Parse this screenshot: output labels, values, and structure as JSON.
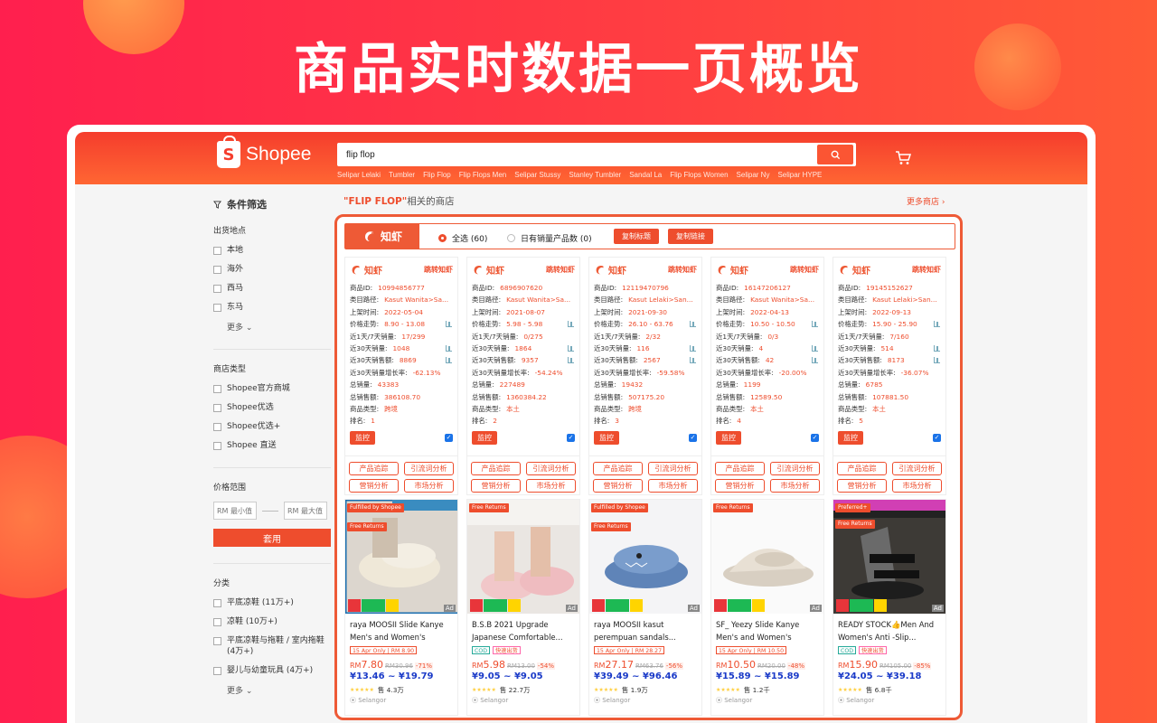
{
  "banner": {
    "title": "商品实时数据一页概览"
  },
  "header": {
    "logo_text": "Shopee",
    "search_value": "flip flop",
    "suggestions": [
      "Selipar Lelaki",
      "Tumbler",
      "Flip Flop",
      "Flip Flops Men",
      "Selipar Stussy",
      "Stanley Tumbler",
      "Sandal La",
      "Flip Flops Women",
      "Selipar Ny",
      "Selipar HYPE"
    ]
  },
  "sidebar": {
    "filter_title": "条件筛选",
    "shipping": {
      "title": "出货地点",
      "options": [
        "本地",
        "海外",
        "西马",
        "东马"
      ],
      "more": "更多"
    },
    "shop_type": {
      "title": "商店类型",
      "options": [
        "Shopee官方商城",
        "Shopee优选",
        "Shopee优选+",
        "Shopee 直送"
      ]
    },
    "price": {
      "title": "价格范围",
      "min_placeholder": "RM 最小值",
      "max_placeholder": "RM 最大值",
      "apply": "套用"
    },
    "category": {
      "title": "分类",
      "options": [
        "平底凉鞋 (11万+)",
        "凉鞋 (10万+)",
        "平底凉鞋与拖鞋 / 室内拖鞋 (4万+)",
        "婴儿与幼童玩具 (4万+)"
      ],
      "more": "更多"
    }
  },
  "shops_heading": {
    "keyword": "\"FLIP FLOP\"",
    "suffix": "相关的商店",
    "more": "更多商店"
  },
  "ext": {
    "logo_text": "知虾",
    "select_all": "全选 (60)",
    "has_sales": "日有销量产品数 (0)",
    "copy_title": "复制标题",
    "copy_link": "复制链接",
    "jump_label": "跳转知虾",
    "monitor_label": "监控",
    "actions": [
      "产品追踪",
      "引流词分析",
      "营销分析",
      "市场分析"
    ],
    "field_labels": {
      "id": "商品ID:",
      "path": "类目路径:",
      "listed": "上架时间:",
      "price_trend": "价格走势:",
      "sales_1_7": "近1天/7天销量:",
      "sales_30": "近30天销量:",
      "revenue_30": "近30天销售额:",
      "growth_30": "近30天销量增长率:",
      "total_sales": "总销量:",
      "total_revenue": "总销售额:",
      "shop_type": "商品类型:",
      "rank": "排名:"
    }
  },
  "products": [
    {
      "id": "10994856777",
      "path": "Kasut Wanita>Sa...",
      "listed": "2022-05-04",
      "price_trend": "8.90 - 13.08",
      "sales_1_7": "17/299",
      "sales_30": "1048",
      "revenue_30": "8869",
      "growth_30": "-62.13%",
      "total_sales": "43383",
      "total_revenue": "386108.70",
      "shop_type": "跨境",
      "rank": "1",
      "fulfilled": "Fulfilled by Shopee",
      "free_returns": "Free Returns",
      "title": "raya MOOSII Slide Kanye Men's and Women's Casu...",
      "tags": [
        "15 Apr Only | RM 8.90"
      ],
      "price": "7.80",
      "old_price": "RM30.96",
      "discount": "-71%",
      "cny": "¥13.46 ~ ¥19.79",
      "sold": "售 4.3万",
      "location": "Selangor",
      "brand": "MOOSII"
    },
    {
      "id": "6896907620",
      "path": "Kasut Wanita>Sa...",
      "listed": "2021-08-07",
      "price_trend": "5.98 - 5.98",
      "sales_1_7": "0/275",
      "sales_30": "1864",
      "revenue_30": "9357",
      "growth_30": "-54.24%",
      "total_sales": "227489",
      "total_revenue": "1360384.22",
      "shop_type": "本土",
      "rank": "2",
      "fulfilled": "",
      "free_returns": "Free Returns",
      "title": "B.S.B 2021 Upgrade Japanese Comfortable...",
      "tags": [
        "COD",
        "快速出货"
      ],
      "price": "5.98",
      "old_price": "RM13.00",
      "discount": "-54%",
      "cny": "¥9.05 ~ ¥9.05",
      "sold": "售 22.7万",
      "location": "Selangor",
      "brand": "nic Design"
    },
    {
      "id": "12119470796",
      "path": "Kasut Lelaki>San...",
      "listed": "2021-09-30",
      "price_trend": "26.10 - 63.76",
      "sales_1_7": "2/32",
      "sales_30": "116",
      "revenue_30": "2567",
      "growth_30": "-59.58%",
      "total_sales": "19432",
      "total_revenue": "507175.20",
      "shop_type": "跨境",
      "rank": "3",
      "fulfilled": "Fulfilled by Shopee",
      "free_returns": "Free Returns",
      "title": "raya MOOSII kasut perempuan sandals...",
      "tags": [
        "15 Apr Only | RM 28.27"
      ],
      "price": "27.17",
      "old_price": "RM63.76",
      "discount": "-56%",
      "cny": "¥39.49 ~ ¥96.46",
      "sold": "售 1.9万",
      "location": "Selangor",
      "brand": ""
    },
    {
      "id": "16147206127",
      "path": "Kasut Wanita>Sa...",
      "listed": "2022-04-13",
      "price_trend": "10.50 - 10.50",
      "sales_1_7": "0/3",
      "sales_30": "4",
      "revenue_30": "42",
      "growth_30": "-20.00%",
      "total_sales": "1199",
      "total_revenue": "12589.50",
      "shop_type": "本土",
      "rank": "4",
      "fulfilled": "",
      "free_returns": "Free Returns",
      "title": "SF_ Yeezy Slide Kanye Men's and Women's Casu...",
      "tags": [
        "15 Apr Only | RM 10.50"
      ],
      "price": "10.50",
      "old_price": "RM20.00",
      "discount": "-48%",
      "cny": "¥15.89 ~ ¥15.89",
      "sold": "售 1.2千",
      "location": "Selangor",
      "brand": ""
    },
    {
      "id": "19145152627",
      "path": "Kasut Lelaki>San...",
      "listed": "2022-09-13",
      "price_trend": "15.90 - 25.90",
      "sales_1_7": "7/160",
      "sales_30": "514",
      "revenue_30": "8173",
      "growth_30": "-36.07%",
      "total_sales": "6785",
      "total_revenue": "107881.50",
      "shop_type": "本土",
      "rank": "5",
      "fulfilled": "Preferred+",
      "free_returns": "Free Returns",
      "title": "READY STOCK👍Men And Women's Anti -Slip...",
      "tags": [
        "COD",
        "快速出货"
      ],
      "price": "15.90",
      "old_price": "RM105.00",
      "discount": "-85%",
      "cny": "¥24.05 ~ ¥39.18",
      "sold": "售 6.8千",
      "location": "Selangor",
      "brand": "Kasut Lelaki"
    }
  ],
  "colors": {
    "brand": "#ee4d2d",
    "bg_red": "#ff1f4e",
    "cny_blue": "#1a3ac8"
  }
}
